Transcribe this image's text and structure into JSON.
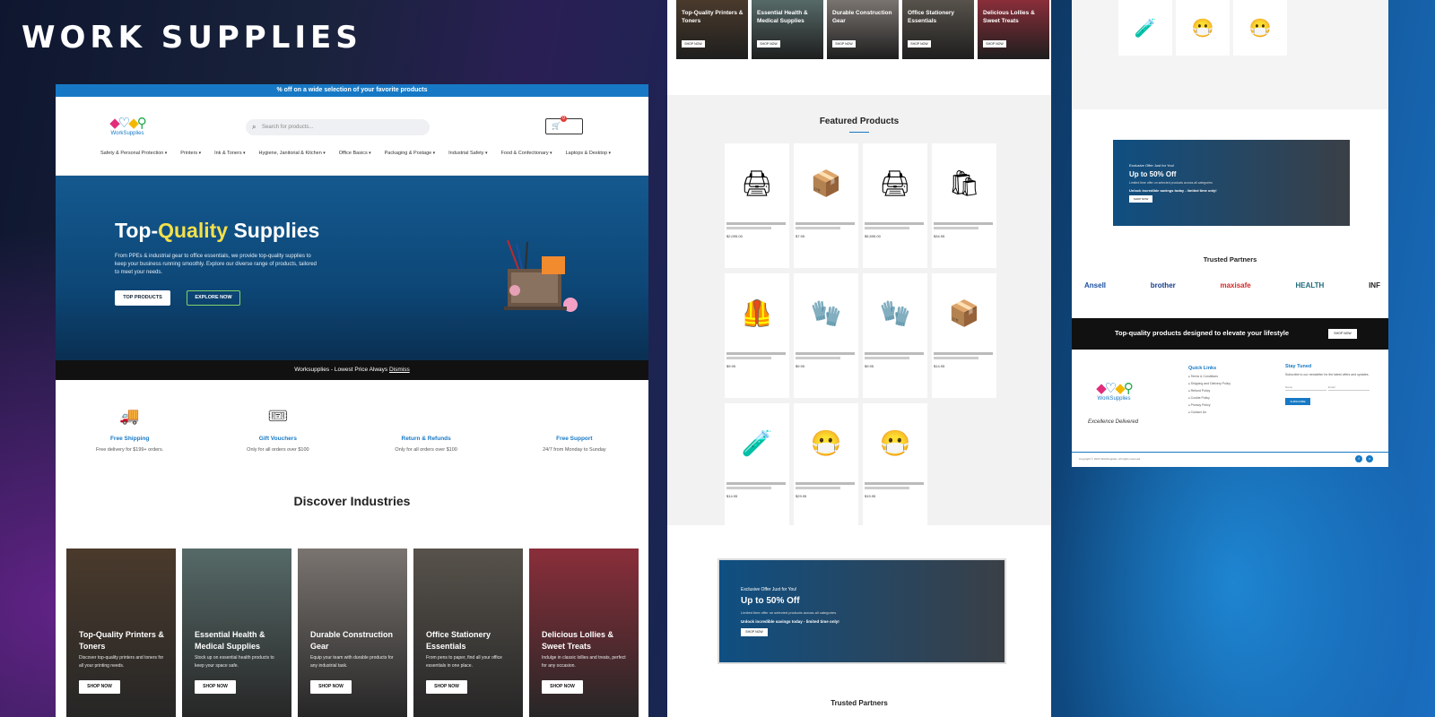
{
  "brand_title": "WORK SUPPLIES",
  "promo_bar": "% off on a wide selection of your favorite products",
  "logo_text": "WorkSupplies",
  "search": {
    "placeholder": "Search for products..."
  },
  "cart": {
    "icon": "cart-icon",
    "count": "0"
  },
  "nav": [
    "Safety & Personal Protection",
    "Printers",
    "Ink & Toners",
    "Hygiene, Janitorial & Kitchen",
    "Office Basics",
    "Packaging & Postage",
    "Industrial Safety",
    "Food & Confectionary",
    "Laptops & Desktop"
  ],
  "hero": {
    "title_pre": "Top-",
    "title_hl": "Quality",
    "title_post": " Supplies",
    "desc": "From PPEs & industrial gear to office essentials, we provide top-quality supplies to keep your business running smoothly. Explore our diverse range of products, tailored to meet your needs.",
    "btn_products": "TOP PRODUCTS",
    "btn_explore": "EXPLORE NOW"
  },
  "strip": {
    "text": "Worksupplies - Lowest Price Always",
    "link": "Dismiss"
  },
  "features": [
    {
      "icon": "truck-icon",
      "title": "Free Shipping",
      "desc": "Free delivery for $199+ orders."
    },
    {
      "icon": "voucher-icon",
      "title": "Gift Vouchers",
      "desc": "Only for all orders over $100"
    },
    {
      "icon": "return-icon",
      "title": "Return & Refunds",
      "desc": "Only for all orders over $100"
    },
    {
      "icon": "support-icon",
      "title": "Free Support",
      "desc": "24/7 from Monday to Sunday"
    }
  ],
  "discover_title": "Discover Industries",
  "categories": [
    {
      "title": "Top-Quality Printers & Toners",
      "desc": "Discover top-quality printers and toners for all your printing needs.",
      "btn": "SHOP NOW",
      "color": "#4a3a2c"
    },
    {
      "title": "Essential Health & Medical Supplies",
      "desc": "Stock up on essential health products to keep your space safe.",
      "btn": "SHOP NOW",
      "color": "#566a68"
    },
    {
      "title": "Durable Construction Gear",
      "desc": "Equip your team with durable products for any industrial task.",
      "btn": "SHOP NOW",
      "color": "#7a7470"
    },
    {
      "title": "Office Stationery Essentials",
      "desc": "From pens to paper, find all your office essentials in one place.",
      "btn": "SHOP NOW",
      "color": "#57524b"
    },
    {
      "title": "Delicious Lollies & Sweet Treats",
      "desc": "Indulge in classic lollies and treats, perfect for any occasion.",
      "btn": "SHOP NOW",
      "color": "#8a2e3a"
    }
  ],
  "p2_categories": [
    {
      "title": "Top-Quality Printers & Toners",
      "btn": "SHOP NOW",
      "color": "#4a3a2c"
    },
    {
      "title": "Essential Health & Medical Supplies",
      "btn": "SHOP NOW",
      "color": "#566a68"
    },
    {
      "title": "Durable Construction Gear",
      "btn": "SHOP NOW",
      "color": "#7a7470"
    },
    {
      "title": "Office Stationery Essentials",
      "btn": "SHOP NOW",
      "color": "#57524b"
    },
    {
      "title": "Delicious Lollies & Sweet Treats",
      "btn": "SHOP NOW",
      "color": "#8a2e3a"
    }
  ],
  "featured_title": "Featured Products",
  "products": [
    {
      "icon": "printer-icon",
      "glyph": "🖨",
      "price": "$2,095.00"
    },
    {
      "icon": "mask-box-icon",
      "glyph": "📦",
      "price": "$7.95"
    },
    {
      "icon": "printer-icon",
      "glyph": "🖨",
      "price": "$5,595.00"
    },
    {
      "icon": "bags-icon",
      "glyph": "🛍",
      "price": "$34.95"
    },
    {
      "icon": "vest-icon",
      "glyph": "🦺",
      "price": "$9.95"
    },
    {
      "icon": "glove-icon",
      "glyph": "🧤",
      "price": "$9.95"
    },
    {
      "icon": "gloves-pack-icon",
      "glyph": "🧤",
      "price": "$9.95"
    },
    {
      "icon": "latex-box-icon",
      "glyph": "📦",
      "price": "$14.95"
    },
    {
      "icon": "test-kit-icon",
      "glyph": "🧪",
      "price": "$14.95"
    },
    {
      "icon": "mask-icon",
      "glyph": "😷",
      "price": "$29.95"
    },
    {
      "icon": "respirator-icon",
      "glyph": "😷",
      "price": "$19.95"
    }
  ],
  "offer": {
    "sub": "Exclusive Offer Just for You!",
    "title": "Up to 50% Off",
    "desc": "Limited time offer on selected products across all categories",
    "desc2": "Unlock incredible savings today - limited time only!",
    "btn": "SHOP NOW"
  },
  "trusted_title": "Trusted Partners",
  "partners": [
    {
      "name": "Ansell",
      "color": "#1b4fa0"
    },
    {
      "name": "brother",
      "color": "#143d8a"
    },
    {
      "name": "maxisafe",
      "color": "#d62828"
    },
    {
      "name": "HEALTH",
      "color": "#1d6b7a"
    },
    {
      "name": "INF",
      "color": "#222222"
    }
  ],
  "cta_bar": {
    "text": "Top-quality products designed to elevate your lifestyle",
    "btn": "SHOP NOW"
  },
  "footer": {
    "signature": "Excellence Delivered",
    "quick_links_title": "Quick Links",
    "quick_links": [
      "Terms & Conditions",
      "Shipping and Delivery Policy",
      "Refund Policy",
      "Cookie Policy",
      "Privacy Policy",
      "Contact Us"
    ],
    "stay_title": "Stay Tuned",
    "stay_desc": "Subscribe to our newsletter for the latest offers and updates.",
    "name_ph": "Name",
    "email_ph": "Email",
    "stay_btn": "SUBSCRIBE",
    "copyright": "Copyright © 2024 WorkSupplies. All rights reserved."
  },
  "accent_color": "#1779c5"
}
